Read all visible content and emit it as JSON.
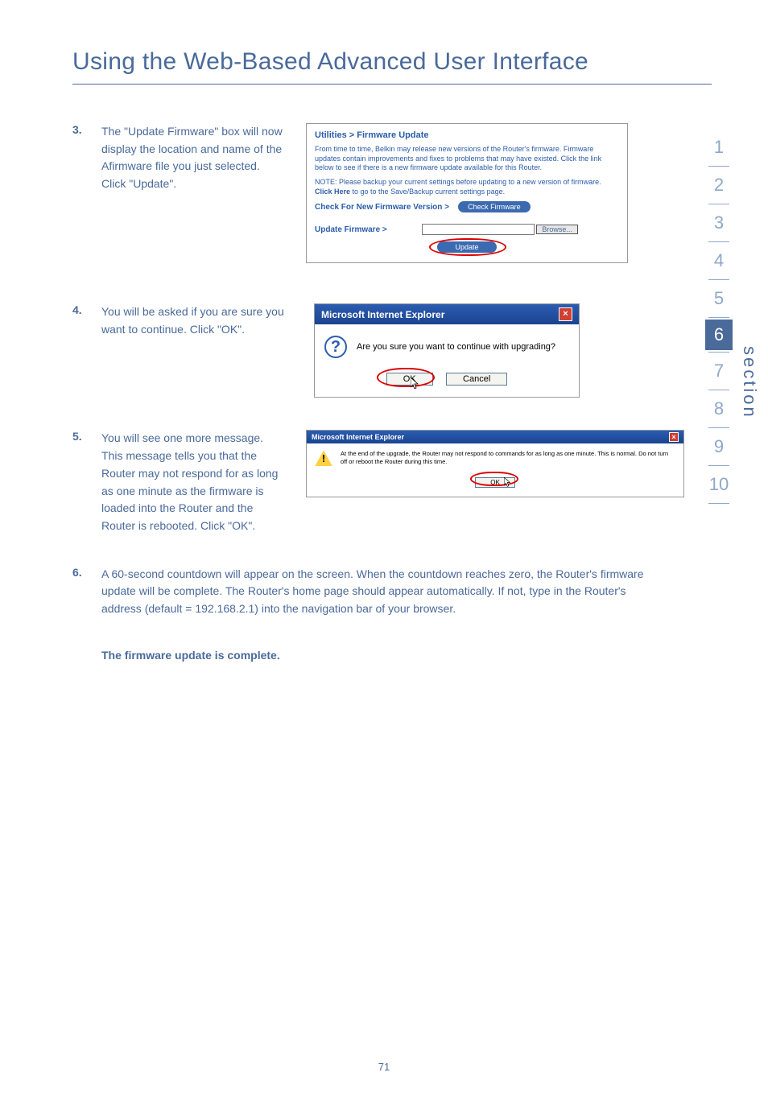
{
  "page_title": "Using the Web-Based Advanced User Interface",
  "section_label": "section",
  "page_number": "71",
  "nav": [
    "1",
    "2",
    "3",
    "4",
    "5",
    "6",
    "7",
    "8",
    "9",
    "10"
  ],
  "nav_active": "6",
  "steps": {
    "s3": {
      "num": "3.",
      "text": "The \"Update Firmware\" box will now display the location and name of the Afirmware file you just selected. Click \"Update\".",
      "dialog": {
        "heading": "Utilities > Firmware Update",
        "p1": "From time to time, Belkin may release new versions of the Router's firmware. Firmware updates contain improvements and fixes to problems that may have existed. Click the link below to see if there is a new firmware update available for this Router.",
        "p2_a": "NOTE: Please backup your current settings before updating to a new version of firmware. ",
        "p2_b": "Click Here",
        "p2_c": " to go to the Save/Backup current settings page.",
        "check_label": "Check For New Firmware Version >",
        "check_btn": "Check Firmware",
        "update_label": "Update Firmware >",
        "browse": "Browse...",
        "update_btn": "Update"
      }
    },
    "s4": {
      "num": "4.",
      "text": "You will be asked if you are sure you want to continue. Click \"OK\".",
      "dialog": {
        "title": "Microsoft Internet Explorer",
        "msg": "Are you sure you want to continue with upgrading?",
        "ok": "OK",
        "cancel": "Cancel"
      }
    },
    "s5": {
      "num": "5.",
      "text": "You will see one more message. This message tells you that the Router may not respond for as long as one minute as the firmware is loaded into the Router and the Router is rebooted. Click \"OK\".",
      "dialog": {
        "title": "Microsoft Internet Explorer",
        "msg": "At the end of the upgrade, the Router may not respond to commands for as long as one minute. This is normal. Do not turn off or reboot the Router during this time.",
        "ok": "OK"
      }
    },
    "s6": {
      "num": "6.",
      "text": "A 60-second countdown will appear on the screen. When the countdown reaches zero, the Router's firmware update will be complete. The Router's home page should appear automatically. If not, type in the Router's address (default = 192.168.2.1) into the navigation bar of your browser."
    }
  },
  "final_bold": "The firmware update is complete."
}
